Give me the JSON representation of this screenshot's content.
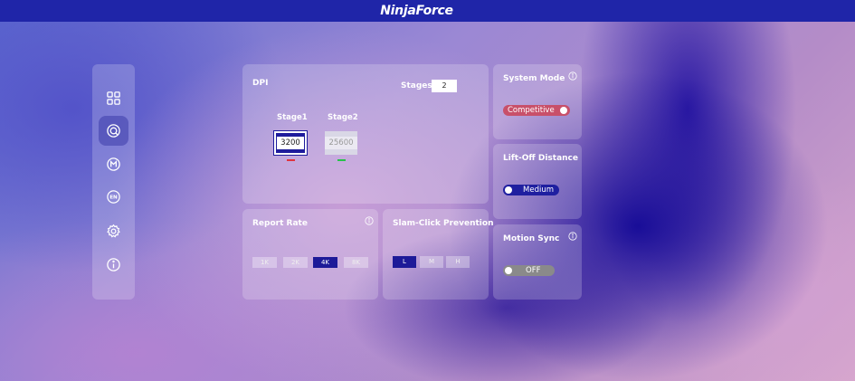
{
  "app": {
    "title": "NinjaForce"
  },
  "sidebar": {
    "items": [
      {
        "icon": "grid-icon"
      },
      {
        "icon": "target-icon",
        "active": true
      },
      {
        "icon": "macro-icon"
      },
      {
        "icon": "language-icon",
        "label": "EN"
      },
      {
        "icon": "gear-icon"
      },
      {
        "icon": "info-icon"
      }
    ]
  },
  "dpi": {
    "title": "DPI",
    "stages_label": "Stages",
    "stages_value": "2",
    "stages": [
      {
        "label": "Stage1",
        "value": "3200",
        "color": "#e0333f",
        "active": true
      },
      {
        "label": "Stage2",
        "value": "25600",
        "color": "#27c24a",
        "active": false
      }
    ]
  },
  "report_rate": {
    "title": "Report Rate",
    "options": [
      "1K",
      "2K",
      "4K",
      "8K"
    ],
    "selected": "4K"
  },
  "slam_click": {
    "title": "Slam-Click Prevention",
    "options": [
      "L",
      "M",
      "H"
    ],
    "selected": "L"
  },
  "system_mode": {
    "title": "System Mode",
    "value": "Competitive",
    "color": "#c8506a"
  },
  "lift_off": {
    "title": "Lift-Off Distance",
    "value": "Medium",
    "color": "#1f1fa0"
  },
  "motion_sync": {
    "title": "Motion Sync",
    "value": "OFF",
    "color": "#8a8a8a"
  },
  "colors": {
    "accent": "#1d1a98",
    "topbar": "#1f25a8"
  }
}
